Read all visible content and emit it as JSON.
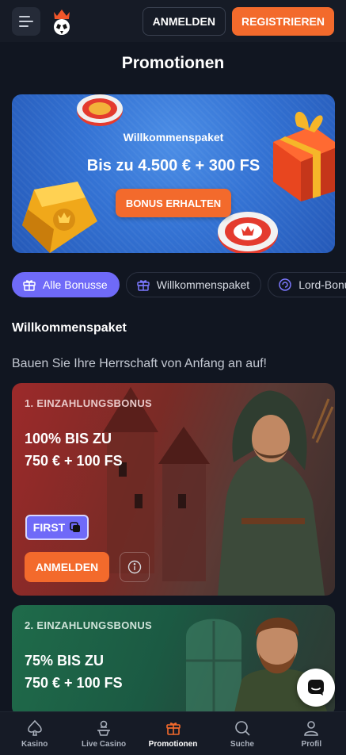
{
  "header": {
    "login_label": "ANMELDEN",
    "register_label": "REGISTRIEREN"
  },
  "page": {
    "title": "Promotionen"
  },
  "hero": {
    "subtitle": "Willkommenspaket",
    "title": "Bis zu 4.500 € + 300 FS",
    "button_label": "BONUS ERHALTEN",
    "bg_color": "#3473d4"
  },
  "tabs": [
    {
      "label": "Alle Bonusse",
      "active": true
    },
    {
      "label": "Willkommenspaket",
      "active": false
    },
    {
      "label": "Lord-Bonus",
      "active": false
    }
  ],
  "section": {
    "title": "Willkommenspaket",
    "description": "Bauen Sie Ihre Herrschaft von Anfang an auf!"
  },
  "cards": [
    {
      "label": "1. EINZAHLUNGSBONUS",
      "headline_line1": "100% BIS ZU",
      "headline_line2": "750 € + 100 FS",
      "code": "FIRST",
      "button_label": "ANMELDEN"
    },
    {
      "label": "2. EINZAHLUNGSBONUS",
      "headline_line1": "75% BIS ZU",
      "headline_line2": "750 € + 100 FS"
    }
  ],
  "nav": [
    {
      "label": "Kasino",
      "icon": "spade-icon"
    },
    {
      "label": "Live Casino",
      "icon": "dealer-icon"
    },
    {
      "label": "Promotionen",
      "icon": "gift-icon",
      "active": true
    },
    {
      "label": "Suche",
      "icon": "search-icon"
    },
    {
      "label": "Profil",
      "icon": "user-icon"
    }
  ],
  "colors": {
    "accent": "#f36a2c",
    "tab_active": "#6f6af8",
    "background": "#111621"
  }
}
